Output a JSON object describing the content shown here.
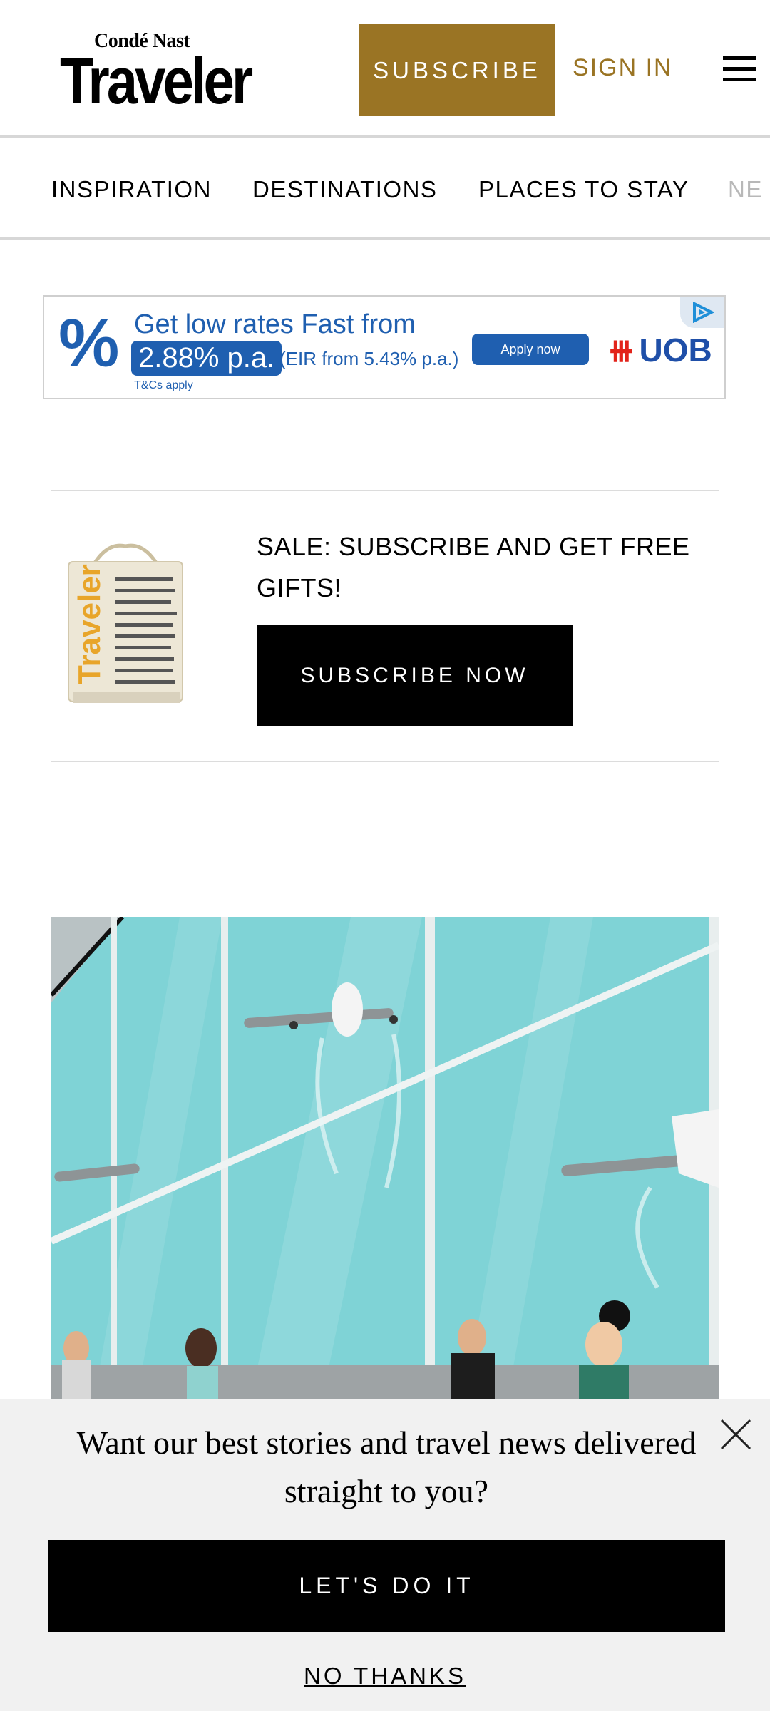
{
  "header": {
    "logo_small": "Condé Nast",
    "logo_big": "Traveler",
    "subscribe_label": "SUBSCRIBE",
    "sign_in_label": "SIGN IN",
    "menu_icon": "hamburger-menu-icon",
    "accent_color": "#9a7424"
  },
  "nav": {
    "items": [
      "INSPIRATION",
      "DESTINATIONS",
      "PLACES TO STAY",
      "NE"
    ]
  },
  "ad": {
    "line1": "Get low rates Fast from",
    "rate": "2.88% p.a.",
    "eir": "(EIR from 5.43% p.a.)",
    "apply_label": "Apply now",
    "brand": "UOB",
    "tcs": "T&Cs apply"
  },
  "promo": {
    "text": "SALE: SUBSCRIBE AND GET FREE GIFTS!",
    "button_label": "SUBSCRIBE NOW",
    "tote_logo": "Traveler"
  },
  "sheet": {
    "message": "Want our best stories and travel news delivered straight to you?",
    "cta_label": "LET'S DO IT",
    "dismiss_label": "NO THANKS",
    "close_icon": "close-icon"
  }
}
